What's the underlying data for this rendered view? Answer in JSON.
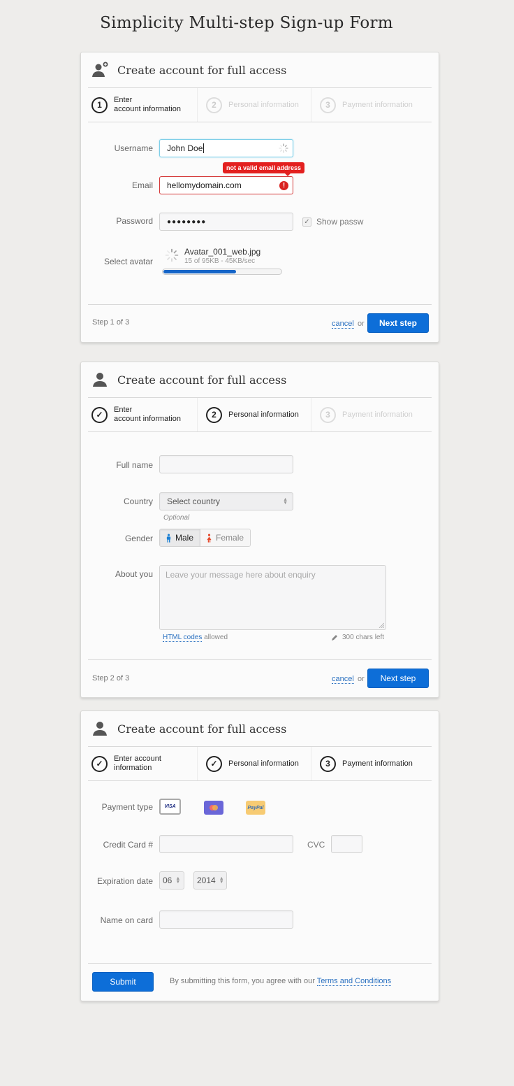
{
  "page": {
    "title": "Simplicity Multi-step Sign-up Form"
  },
  "colors": {
    "accent": "#0d6ed8",
    "error": "#e3201f",
    "focus": "#7fcfe8"
  },
  "cards": [
    {
      "title": "Create account for full access",
      "header_icon": "user-add-icon",
      "steps": [
        {
          "num": "1",
          "label_line1": "Enter",
          "label_line2": "account information",
          "state": "active"
        },
        {
          "num": "2",
          "label": "Personal information",
          "state": "pending"
        },
        {
          "num": "3",
          "label": "Payment information",
          "state": "pending"
        }
      ],
      "fields": {
        "username": {
          "label": "Username",
          "value": "John Doe"
        },
        "email": {
          "label": "Email",
          "value": "hellomydomain.com",
          "error": "not a valid email address"
        },
        "password": {
          "label": "Password",
          "value": "●●●●●●●●",
          "show_label": "Show passw",
          "show_checked": true
        },
        "avatar": {
          "label": "Select avatar",
          "filename": "Avatar_001_web.jpg",
          "status": "15 of 95KB - 45KB/sec",
          "progress_pct": 62
        }
      },
      "footer": {
        "step_text": "Step 1 of 3",
        "cancel": "cancel",
        "or": "or",
        "next": "Next step"
      }
    },
    {
      "title": "Create account for full access",
      "header_icon": "user-icon",
      "steps": [
        {
          "label_line1": "Enter",
          "label_line2": "account information",
          "state": "done"
        },
        {
          "num": "2",
          "label": "Personal information",
          "state": "active"
        },
        {
          "num": "3",
          "label": "Payment information",
          "state": "pending"
        }
      ],
      "fields": {
        "fullname": {
          "label": "Full name",
          "value": ""
        },
        "country": {
          "label": "Country",
          "value": "Select country",
          "hint": "Optional"
        },
        "gender": {
          "label": "Gender",
          "options": [
            "Male",
            "Female"
          ],
          "selected": "Male"
        },
        "about": {
          "label": "About you",
          "placeholder": "Leave your message here about enquiry",
          "html_link": "HTML codes",
          "html_suffix": "allowed",
          "chars_left": "300 chars left"
        }
      },
      "footer": {
        "step_text": "Step 2 of 3",
        "cancel": "cancel",
        "or": "or",
        "next": "Next step"
      }
    },
    {
      "title": "Create account for full access",
      "header_icon": "user-icon",
      "steps": [
        {
          "label_line1": "Enter account",
          "label_line2": "information",
          "state": "done"
        },
        {
          "label": "Personal information",
          "state": "done"
        },
        {
          "num": "3",
          "label": "Payment information",
          "state": "active"
        }
      ],
      "fields": {
        "payment_type": {
          "label": "Payment type",
          "options": [
            "VISA",
            "MasterCard",
            "PayPal"
          ],
          "selected": "VISA"
        },
        "card_number": {
          "label": "Credit Card #",
          "value": ""
        },
        "cvc": {
          "label": "CVC",
          "value": ""
        },
        "expiration": {
          "label": "Expiration date",
          "month": "06",
          "year": "2014"
        },
        "name_on_card": {
          "label": "Name on card",
          "value": ""
        }
      },
      "footer": {
        "submit": "Submit",
        "agree_text": "By submitting this form, you agree with our",
        "terms_link": "Terms and Conditions"
      }
    }
  ]
}
